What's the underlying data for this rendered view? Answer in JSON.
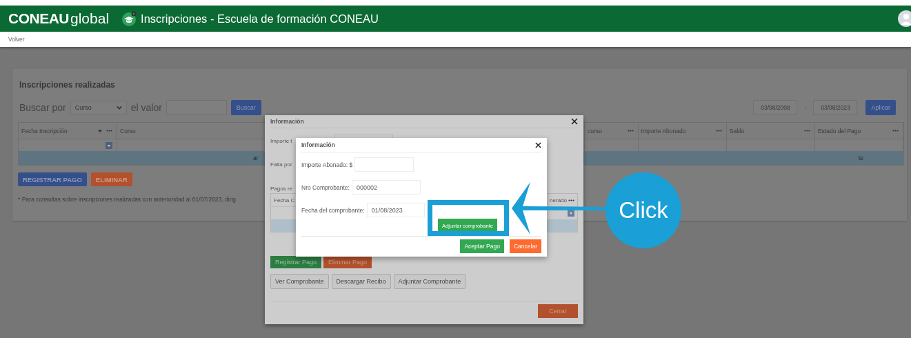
{
  "header": {
    "logo_bold": "CONEAU",
    "logo_light": "global",
    "title": "Inscripciones - Escuela de formación CONEAU"
  },
  "nav": {
    "back_link": "Volver"
  },
  "page": {
    "title": "Inscripciones realizadas",
    "search_label": "Buscar por",
    "search_by": "Curso",
    "value_label": "el valor",
    "search_button": "Buscar",
    "date_from": "03/08/2008",
    "date_separator": "-",
    "date_to": "03/08/2023",
    "apply_button": "Aplicar",
    "columns_left": [
      {
        "label": "Fecha Inscripción",
        "sorted": true,
        "menu": true
      },
      {
        "label": "Curso",
        "sorted": false,
        "menu": false
      }
    ],
    "columns_right": [
      {
        "label": "curso",
        "sorted": false,
        "menu": true
      },
      {
        "label": "Importe Abonado",
        "sorted": false,
        "menu": true
      },
      {
        "label": "Saldo",
        "sorted": false,
        "menu": true
      },
      {
        "label": "Estado del Pago",
        "sorted": false,
        "menu": true
      }
    ],
    "group_row": {
      "left_text": "ar",
      "right_text": "te"
    },
    "buttons": [
      {
        "label": "REGISTRAR PAGO",
        "kind": "primary"
      },
      {
        "label": "ELIMINAR",
        "kind": "danger"
      }
    ],
    "note": "* Para consultas sobre inscripciones realizadas con anterioridad al 01/07/2023, dirig"
  },
  "payments_dialog": {
    "title": "Información",
    "labels": [
      "Importe t",
      "Falta por"
    ],
    "payments_label": "Pagos re",
    "table_left": "Fecha C",
    "table_right": "nerado",
    "actions": [
      {
        "label": "Registrar Pago",
        "kind": "success"
      },
      {
        "label": "Eliminar Pago",
        "kind": "danger"
      }
    ],
    "document_buttons": [
      {
        "label": "Ver Comprobante",
        "kind": "default"
      },
      {
        "label": "Descargar Recibo",
        "kind": "default"
      },
      {
        "label": "Adjuntar Comprobante",
        "kind": "default"
      }
    ],
    "close_button": "Cerrar"
  },
  "payment_dialog": {
    "title": "Información",
    "fields": [
      {
        "label": "Importe Abonado: $"
      },
      {
        "label": "Nro Comprobante:",
        "value": "000002"
      },
      {
        "label": "Fecha del comprobante:",
        "value": "01/08/2023"
      }
    ],
    "attach_button": "Adjuntar comprobante",
    "footer_buttons": [
      {
        "label": "Aceptar Pago",
        "kind": "success"
      },
      {
        "label": "Cancelar",
        "kind": "danger"
      }
    ]
  },
  "annotation": {
    "callout": "Click"
  }
}
